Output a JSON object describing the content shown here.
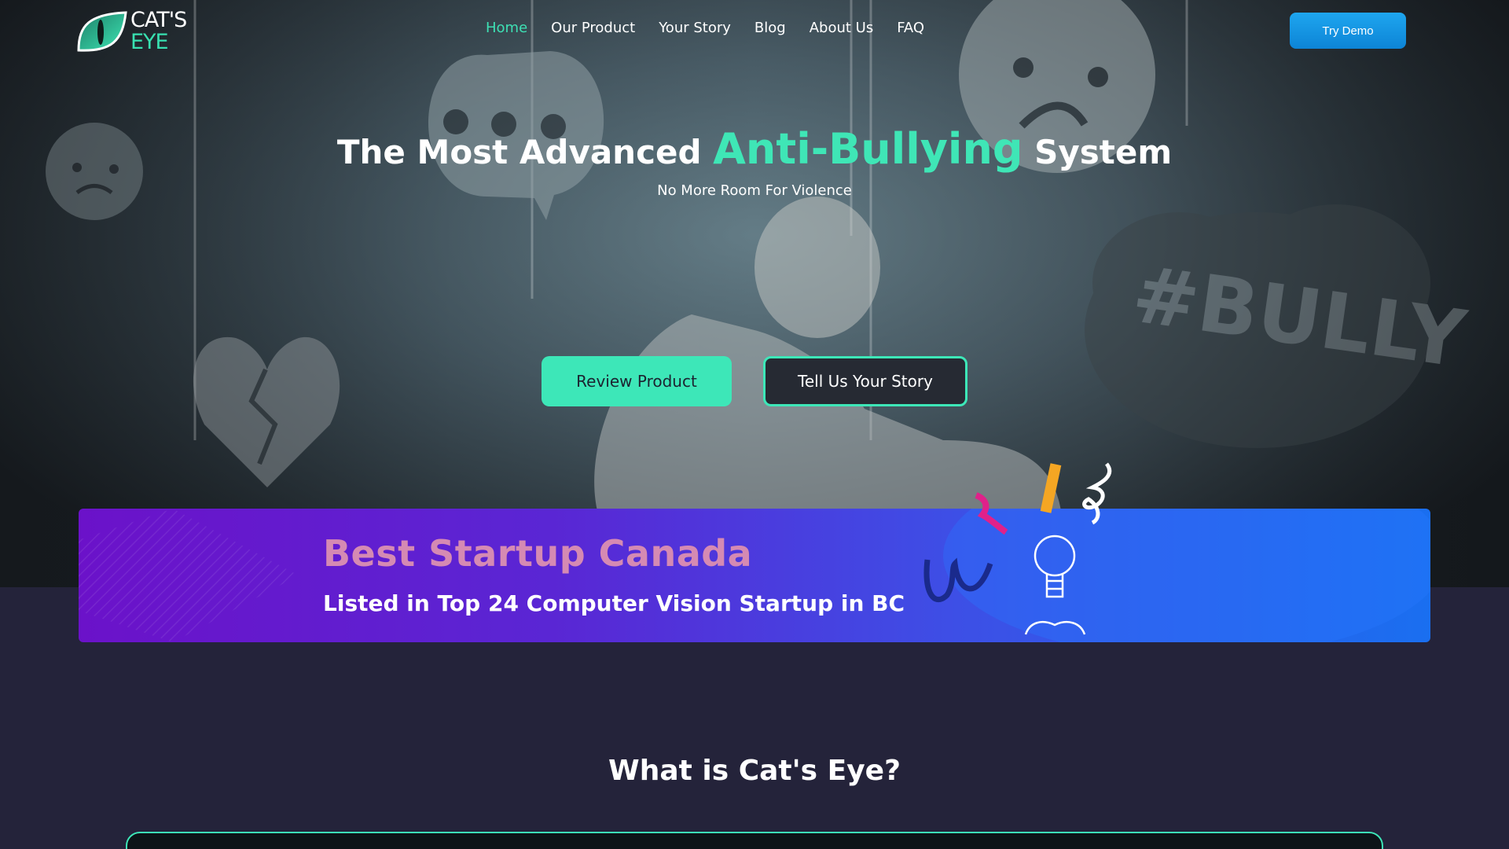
{
  "brand": {
    "line1": "CAT'S",
    "line2": "EYE"
  },
  "nav": {
    "items": [
      {
        "label": "Home",
        "active": true
      },
      {
        "label": "Our Product",
        "active": false
      },
      {
        "label": "Your Story",
        "active": false
      },
      {
        "label": "Blog",
        "active": false
      },
      {
        "label": "About Us",
        "active": false
      },
      {
        "label": "FAQ",
        "active": false
      }
    ],
    "cta": "Try Demo"
  },
  "hero": {
    "headline_pre": "The Most Advanced ",
    "headline_accent": "Anti-Bullying",
    "headline_post": " System",
    "subhead": "No More Room For Violence",
    "primary_button": "Review Product",
    "secondary_button": "Tell Us Your Story"
  },
  "banner": {
    "title": "Best Startup Canada",
    "subtitle": "Listed in Top 24 Computer Vision Startup in BC"
  },
  "section": {
    "title": "What is Cat's Eye?"
  },
  "colors": {
    "accent": "#3de7b8",
    "cta_blue": "#1ea6ef",
    "page_bg": "#24233a",
    "banner_title": "#d58ab3"
  }
}
